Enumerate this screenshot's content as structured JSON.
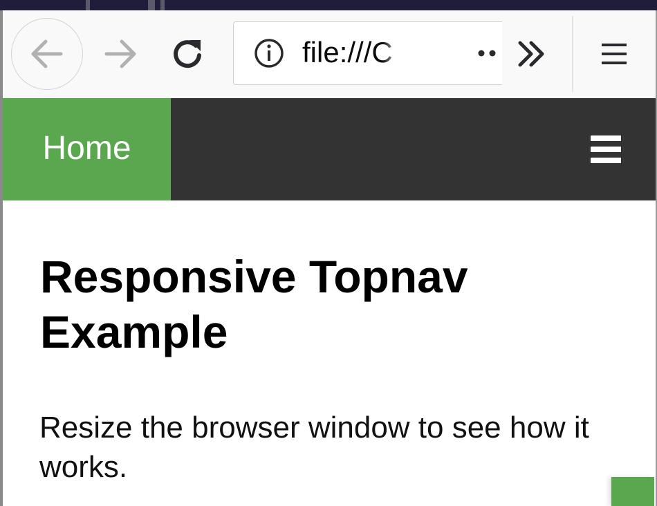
{
  "browser": {
    "url_text": "file:///C",
    "icons": {
      "back": "back-arrow-icon",
      "forward": "forward-arrow-icon",
      "reload": "reload-icon",
      "info": "info-icon",
      "page_actions": "more-dots-icon",
      "overflow": "double-chevron-icon",
      "menu": "hamburger-menu-icon"
    }
  },
  "topnav": {
    "home_label": "Home",
    "menu_icon": "hamburger-icon"
  },
  "content": {
    "heading": "Responsive Topnav Example",
    "paragraph": "Resize the browser window to see how it works."
  },
  "colors": {
    "nav_background": "#333333",
    "nav_active": "#5aa74f",
    "toolbar_background": "#f9f9fa"
  }
}
